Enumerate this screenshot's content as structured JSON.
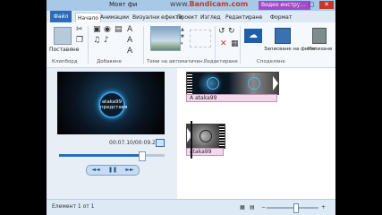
{
  "window": {
    "title": "Моят фи",
    "watermark_prefix": "www.",
    "watermark": "Bandicam.com",
    "tool_pill": "Видео инстру...",
    "buttons": [
      "–",
      "□",
      "✕"
    ]
  },
  "tabs": [
    {
      "label": "Файл",
      "type": "file"
    },
    {
      "label": "Начало",
      "active": true
    },
    {
      "label": "Анимации"
    },
    {
      "label": "Визуални ефекти"
    },
    {
      "label": "Проект"
    },
    {
      "label": "Изглед"
    },
    {
      "label": "Редактиране"
    },
    {
      "label": "Формат"
    }
  ],
  "ribbon": {
    "paste_label": "Поставяне",
    "groups": [
      "Клипборд",
      "Добавяне",
      "Теми на автоматичен...",
      "Редактиране",
      "Споделяне"
    ],
    "save_movie_label": "Записване на филм",
    "exit_label": "Излизане",
    "icons": {
      "cut": "scissors-icon",
      "copy": "copy-icon",
      "paste": "clipboard-icon",
      "add_video": "film-icon",
      "add_music": "music-icon",
      "webcam": "webcam-icon",
      "narration": "microphone-icon",
      "snapshot": "camera-icon",
      "title": "title-icon",
      "caption": "caption-icon",
      "credits": "credits-icon",
      "rotate_left": "rotate-left-icon",
      "rotate_right": "rotate-right-icon",
      "remove": "delete-icon",
      "select_all": "select-all-icon",
      "onedrive": "cloud-icon"
    }
  },
  "preview": {
    "overlay_line1": "ataka99",
    "overlay_line2": "представя",
    "time": "00:07.10/00:09.21",
    "progress": 0.78,
    "controls": [
      "◄◄",
      "❚❚",
      "►►"
    ]
  },
  "storyboard": {
    "clip1_caption": "ataka99",
    "clip2_caption": "ataka99",
    "caption_glyph": "A"
  },
  "status": {
    "text": "Елемент 1 от 1",
    "zoom_out": "−",
    "zoom_in": "+"
  },
  "colors": {
    "accent": "#2b6cb8",
    "caption_fill": "#f4d8ec",
    "close_red": "#c0392b",
    "pill_purple": "#a24dc7"
  }
}
